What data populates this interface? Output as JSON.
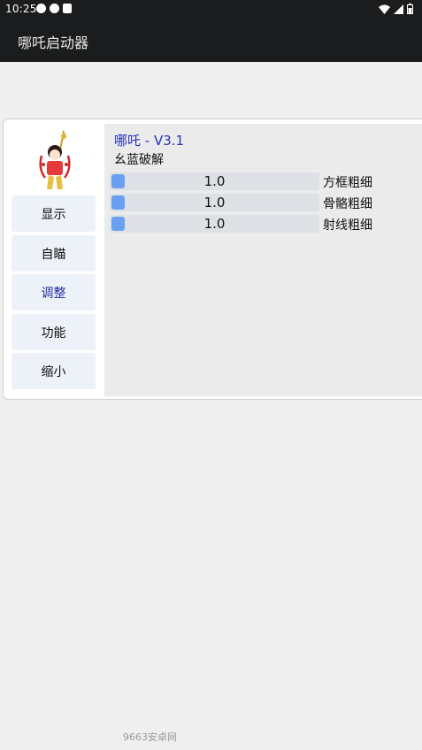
{
  "status_bar": {
    "time": "10:25",
    "left_icons": [
      "telegram-icon",
      "telegram-icon",
      "android-icon"
    ],
    "right_icons": [
      "wifi-icon",
      "signal-icon",
      "battery-icon"
    ]
  },
  "app_bar": {
    "title": "哪吒启动器"
  },
  "panel": {
    "version": "哪吒 - V3.1",
    "subtitle": "幺蓝破解",
    "menu": [
      {
        "label": "显示"
      },
      {
        "label": "自瞄"
      },
      {
        "label": "调整"
      },
      {
        "label": "功能"
      },
      {
        "label": "缩小"
      }
    ],
    "active_menu": "调整",
    "sliders": [
      {
        "value": "1.0",
        "label": "方框粗细"
      },
      {
        "value": "1.0",
        "label": "骨骼粗细"
      },
      {
        "value": "1.0",
        "label": "射线粗细"
      }
    ]
  },
  "watermark": "9663安卓网",
  "colors": {
    "accent": "#2532b8",
    "slider_thumb": "#6aa0f3",
    "menu_bg": "#edf1f8",
    "bar_bg": "#1a1c1e"
  }
}
